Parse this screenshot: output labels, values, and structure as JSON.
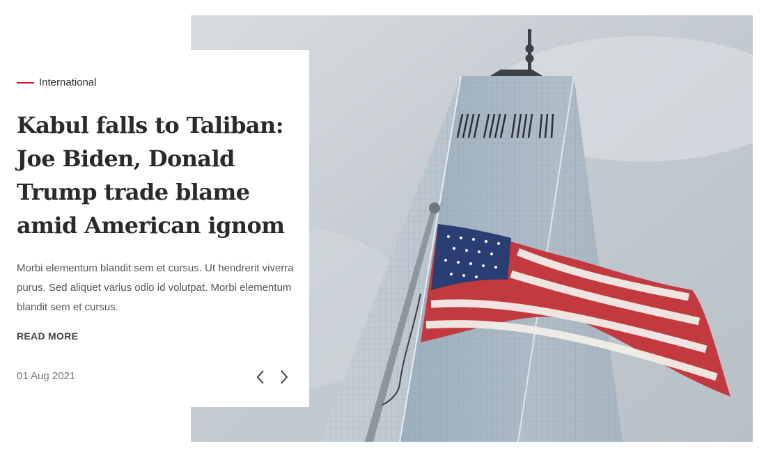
{
  "article": {
    "category": "International",
    "headline": "Kabul falls to Taliban: Joe Biden, Donald Trump trade blame amid American ignom",
    "excerpt": "Morbi elementum blandit sem et cursus. Ut hendrerit viverra purus. Sed aliquet varius odio id volutpat. Morbi elementum blandit sem et cursus.",
    "read_more_label": "READ MORE",
    "date": "01 Aug 2021"
  },
  "slider": {
    "prev_icon": "chevron-left-icon",
    "next_icon": "chevron-right-icon"
  },
  "colors": {
    "accent": "#c8102e",
    "headline": "#2a2a2a",
    "sky": "#c9d0d6"
  }
}
